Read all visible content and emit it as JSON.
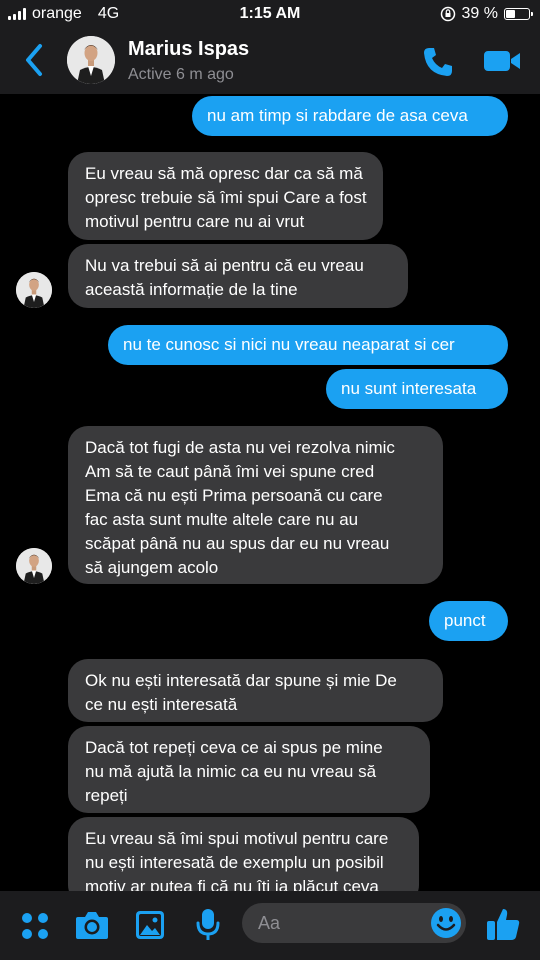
{
  "status_bar": {
    "carrier": "orange",
    "network": "4G",
    "time": "1:15 AM",
    "battery": "39 %"
  },
  "header": {
    "name": "Marius Ispas",
    "status": "Active 6 m ago"
  },
  "messages": [
    {
      "from": "me",
      "text": "nu am timp si rabdare de asa ceva"
    },
    {
      "from": "them",
      "lines": [
        "Eu vreau să mă opresc dar ca să mă",
        "opresc trebuie să îmi spui Care a fost",
        "motivul pentru care nu ai vrut"
      ]
    },
    {
      "from": "them",
      "lines": [
        "Nu va trebui să ai pentru că eu vreau",
        "această informație de la tine"
      ]
    },
    {
      "from": "me",
      "text": "nu te cunosc si nici nu vreau neaparat si cer"
    },
    {
      "from": "me",
      "text": "nu sunt interesata"
    },
    {
      "from": "them",
      "lines": [
        "Dacă tot fugi de asta nu vei rezolva nimic",
        "Am să te caut până îmi vei spune cred",
        "Ema că nu ești Prima persoană cu care",
        "fac asta sunt multe altele care nu au",
        "scăpat până nu au spus dar eu nu vreau",
        "să ajungem acolo"
      ]
    },
    {
      "from": "me",
      "text": "punct"
    },
    {
      "from": "them",
      "lines": [
        "Ok nu ești interesată dar spune și mie De",
        "ce nu ești interesată"
      ]
    },
    {
      "from": "them",
      "lines": [
        "Dacă tot repeți ceva ce ai spus pe mine",
        "nu mă ajută la nimic ca eu nu vreau să",
        "repeți"
      ]
    },
    {
      "from": "them",
      "lines": [
        "Eu vreau să îmi spui motivul pentru care",
        "nu ești interesată de exemplu un posibil",
        "motiv ar putea fi că nu îți ia plăcut ceva"
      ]
    }
  ],
  "composer": {
    "placeholder": "Aa"
  },
  "colors": {
    "accent": "#1ba1f2",
    "incoming_bubble": "#3a3a3c",
    "bar_background": "#1c1c1e"
  },
  "icons": [
    "back-chevron-icon",
    "phone-icon",
    "video-camera-icon",
    "apps-grid-icon",
    "camera-icon",
    "gallery-icon",
    "microphone-icon",
    "emoji-icon",
    "thumbs-up-icon"
  ]
}
